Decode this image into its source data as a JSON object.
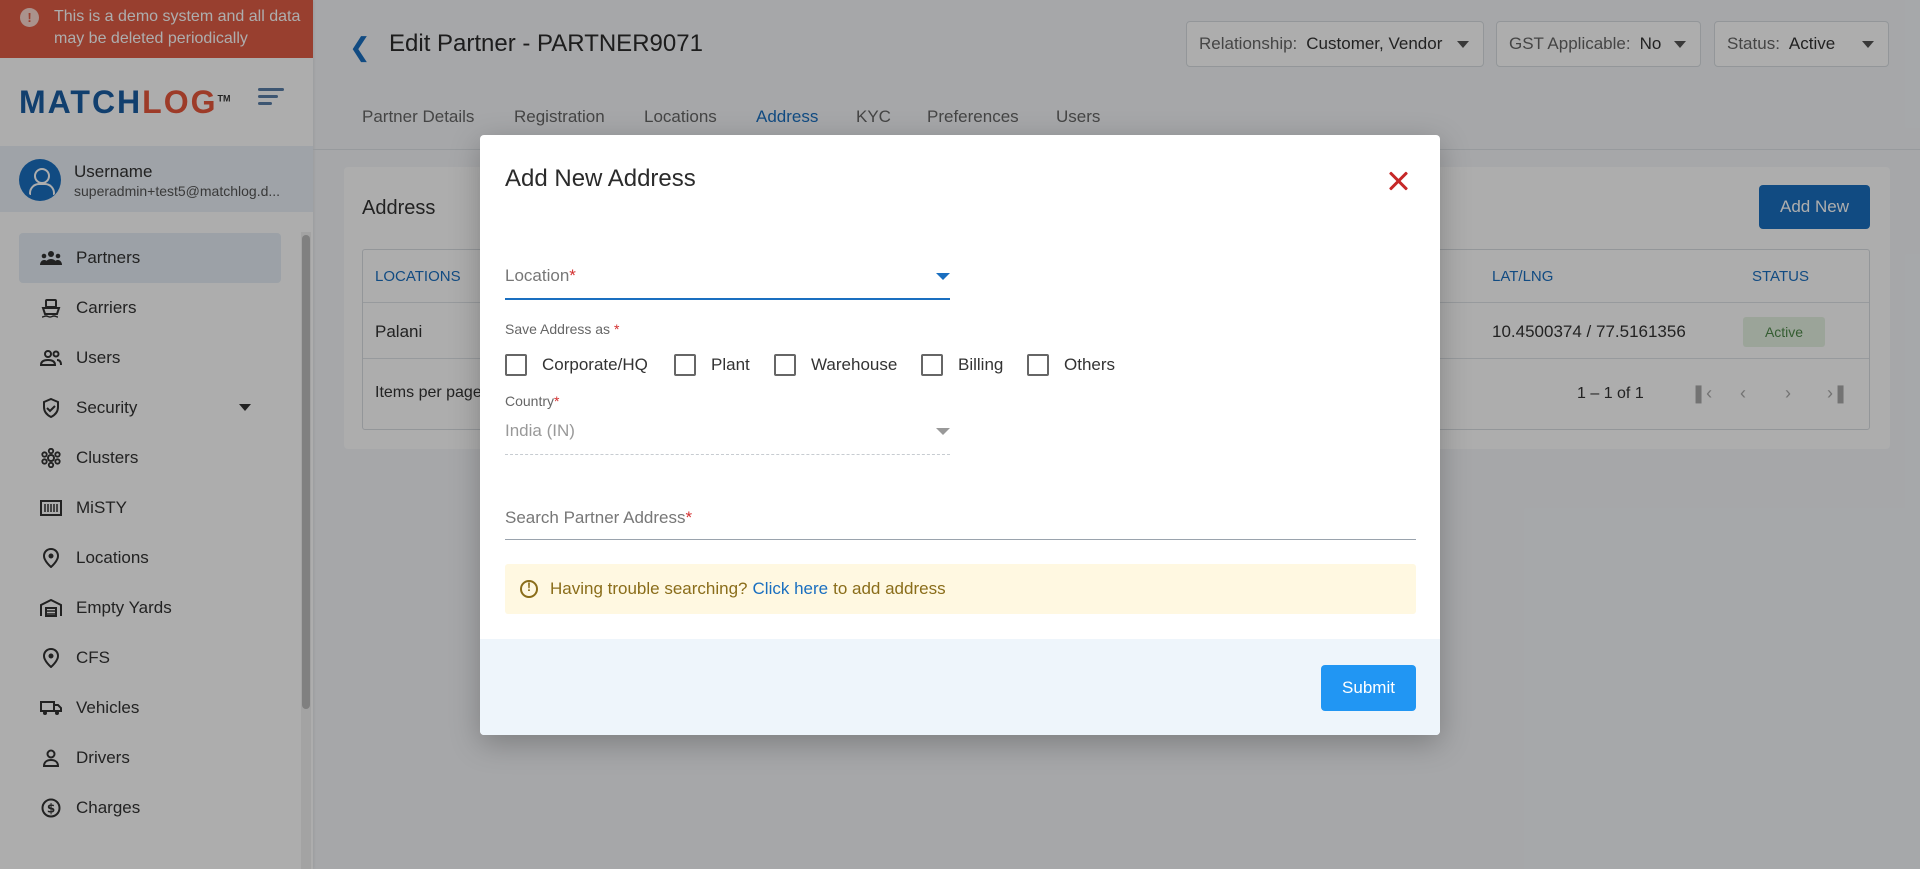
{
  "demo_banner": {
    "text": "This is a demo system and all data may be deleted periodically"
  },
  "brand": {
    "logo_match": "MATCH",
    "logo_log": "LOG",
    "logo_tm": "TM",
    "accent": "#1a6fc0",
    "brand_red": "#e8573c"
  },
  "user": {
    "name": "Username",
    "email": "superadmin+test5@matchlog.d..."
  },
  "sidebar": {
    "items": [
      {
        "label": "Partners",
        "icon": "partners-icon",
        "active": true
      },
      {
        "label": "Carriers",
        "icon": "ship-icon"
      },
      {
        "label": "Users",
        "icon": "users-icon"
      },
      {
        "label": "Security",
        "icon": "shield-icon",
        "has_caret": true
      },
      {
        "label": "Clusters",
        "icon": "cluster-icon"
      },
      {
        "label": "MiSTY",
        "icon": "barcode-icon"
      },
      {
        "label": "Locations",
        "icon": "location-pin-icon"
      },
      {
        "label": "Empty Yards",
        "icon": "warehouse-icon"
      },
      {
        "label": "CFS",
        "icon": "location-pin-icon"
      },
      {
        "label": "Vehicles",
        "icon": "truck-icon"
      },
      {
        "label": "Drivers",
        "icon": "person-icon"
      },
      {
        "label": "Charges",
        "icon": "dollar-icon"
      }
    ]
  },
  "header": {
    "title": "Edit Partner - PARTNER9071",
    "relationship": {
      "label": "Relationship:",
      "value": "Customer, Vendor"
    },
    "gst": {
      "label": "GST Applicable:",
      "value": "No"
    },
    "status": {
      "label": "Status:",
      "value": "Active"
    }
  },
  "tabs": [
    {
      "label": "Partner Details"
    },
    {
      "label": "Registration"
    },
    {
      "label": "Locations"
    },
    {
      "label": "Address",
      "active": true
    },
    {
      "label": "KYC"
    },
    {
      "label": "Preferences"
    },
    {
      "label": "Users"
    }
  ],
  "address_card": {
    "title": "Address",
    "add_new": "Add New",
    "columns": {
      "locations": "LOCATIONS",
      "latlng": "LAT/LNG",
      "status": "STATUS"
    },
    "rows": [
      {
        "location": "Palani",
        "latlng": "10.4500374 / 77.5161356",
        "status": "Active"
      }
    ],
    "items_per_page": "Items per page",
    "range": "1 – 1 of 1"
  },
  "modal": {
    "title": "Add New Address",
    "location_label": "Location",
    "save_as_label": "Save Address as",
    "save_as_options": [
      "Corporate/HQ",
      "Plant",
      "Warehouse",
      "Billing",
      "Others"
    ],
    "country_label": "Country",
    "country_value": "India (IN)",
    "search_label": "Search Partner Address",
    "hint": {
      "before": "Having trouble searching?",
      "link": "Click here",
      "after": "to add address"
    },
    "submit": "Submit",
    "required_mark": "*"
  }
}
